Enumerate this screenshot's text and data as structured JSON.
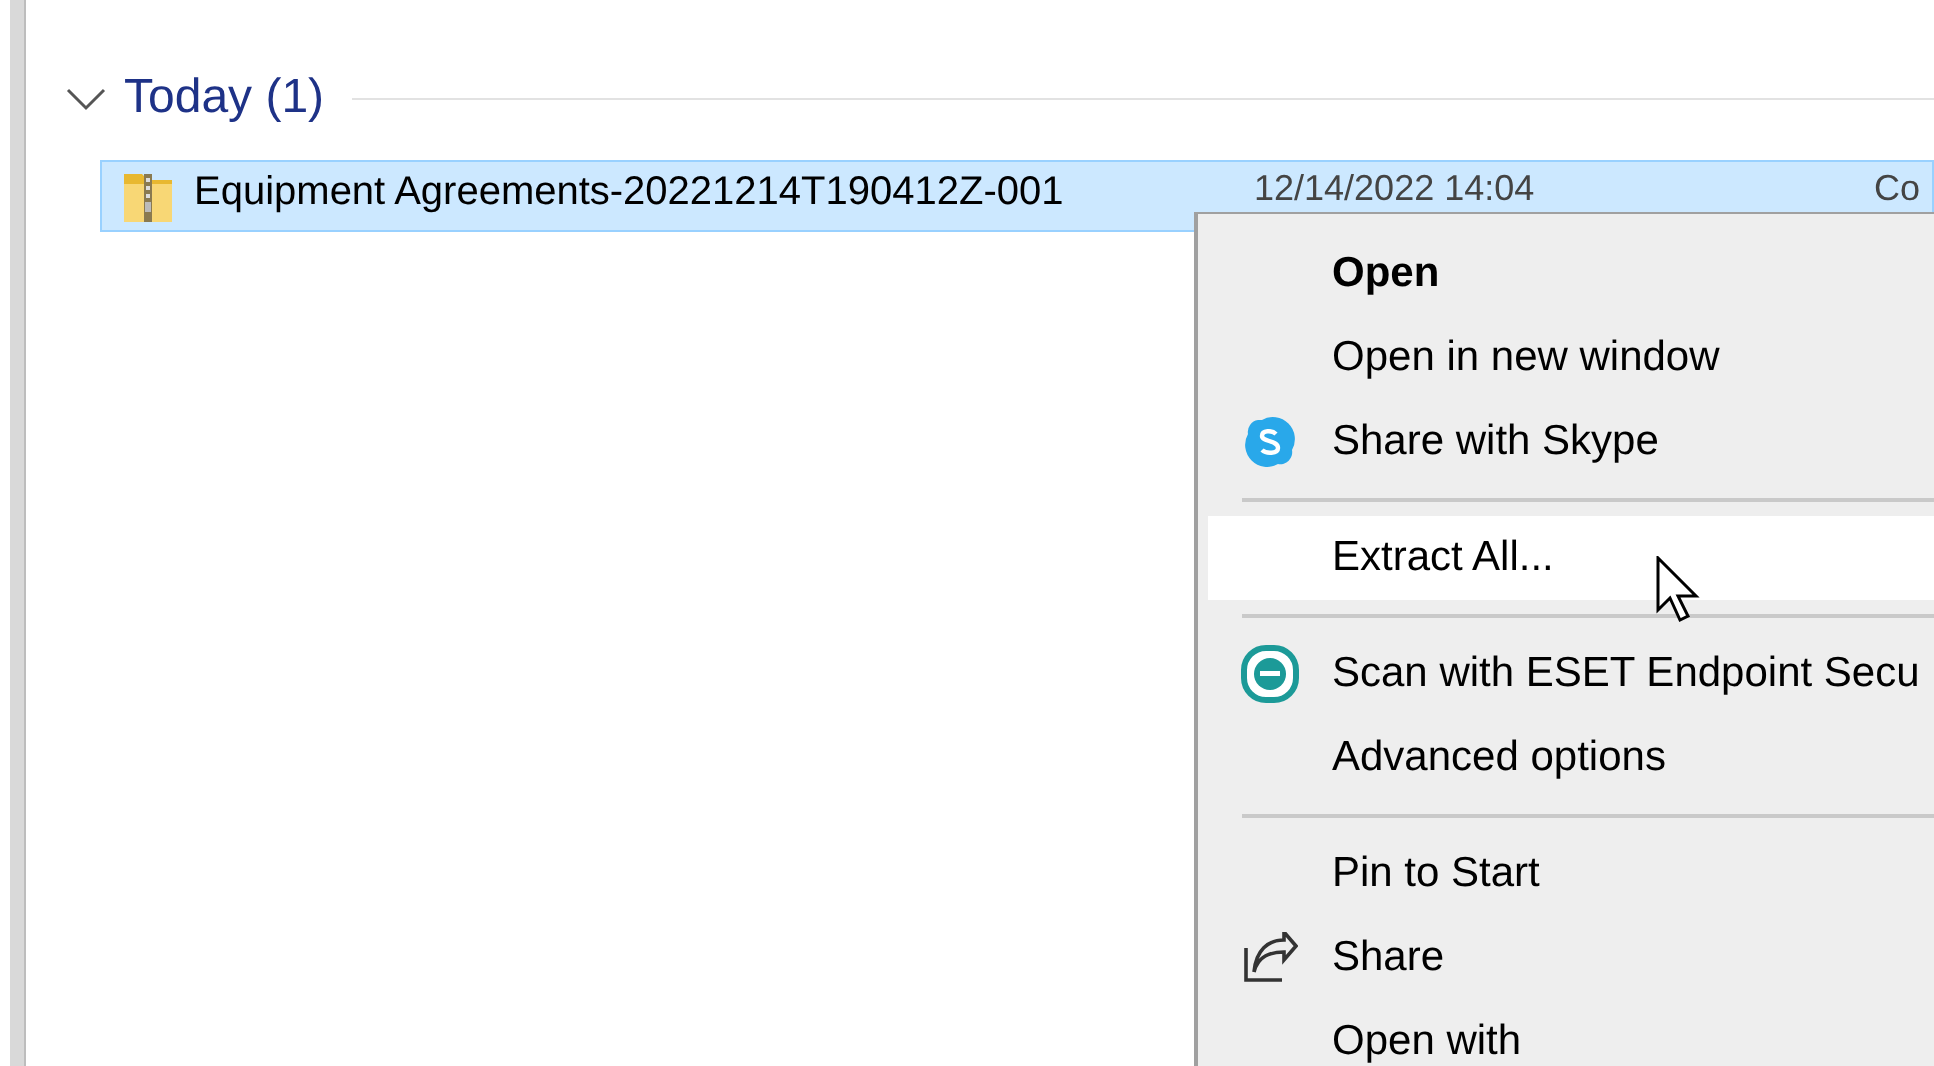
{
  "group": {
    "label": "Today (1)",
    "expanded": true
  },
  "files": [
    {
      "name": "Equipment Agreements-20221214T190412Z-001",
      "date": "12/14/2022 14:04",
      "column_3": "Co",
      "selected": true
    }
  ],
  "context_menu": {
    "items": [
      {
        "kind": "item",
        "label": "Open",
        "default": true,
        "selected": false
      },
      {
        "kind": "item",
        "label": "Open in new window",
        "default": false,
        "selected": false
      },
      {
        "kind": "skype",
        "label": "Share with Skype",
        "default": false,
        "selected": false
      },
      {
        "kind": "separator"
      },
      {
        "kind": "item",
        "label": "Extract All...",
        "default": false,
        "selected": true
      },
      {
        "kind": "separator"
      },
      {
        "kind": "eset",
        "label": "Scan with ESET Endpoint Secu",
        "default": false,
        "selected": false
      },
      {
        "kind": "item",
        "label": "Advanced options",
        "default": false,
        "selected": false
      },
      {
        "kind": "separator"
      },
      {
        "kind": "item",
        "label": "Pin to Start",
        "default": false,
        "selected": false
      },
      {
        "kind": "share",
        "label": "Share",
        "default": false,
        "selected": false
      },
      {
        "kind": "item",
        "label": "Open with",
        "default": false,
        "selected": false
      }
    ]
  }
}
